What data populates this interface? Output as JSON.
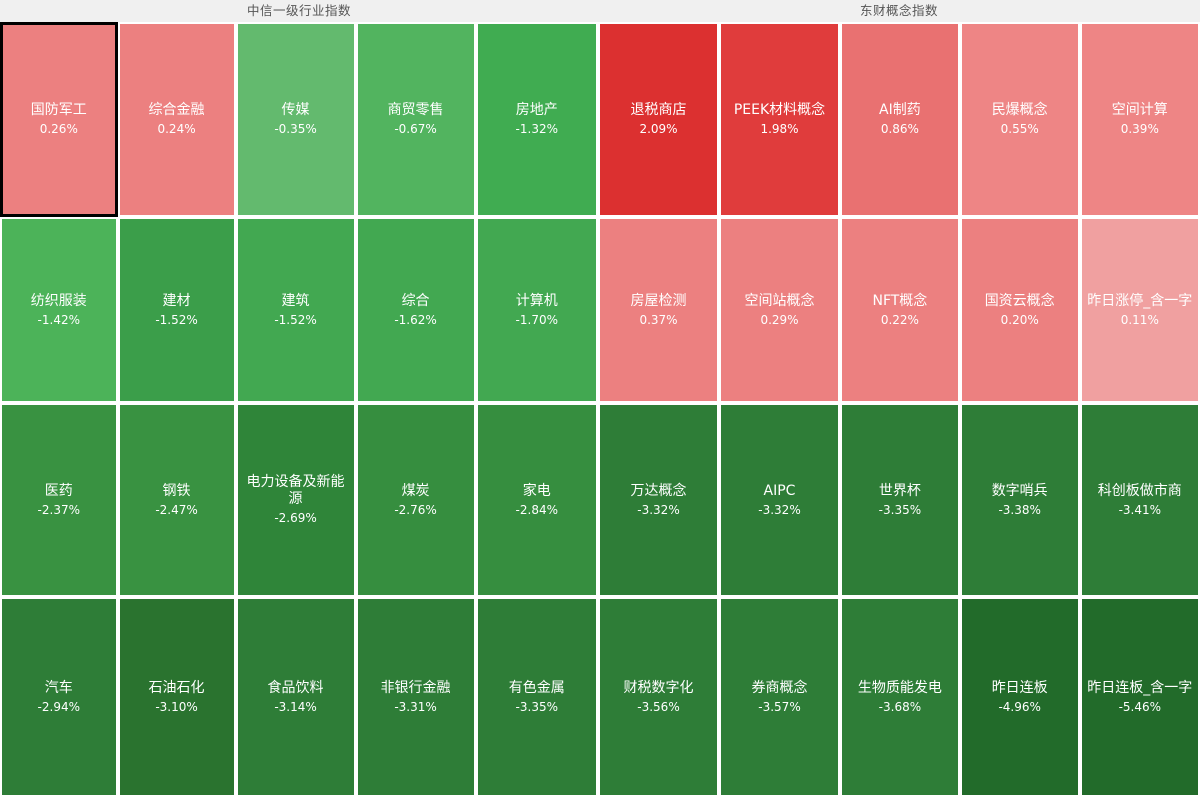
{
  "panels": [
    {
      "title": "中信一级行业指数",
      "rows": [
        {
          "height_pct": 25.2,
          "cells": [
            {
              "label": "国防军工",
              "value": "0.26%",
              "change": 0.26,
              "color": "#ec8080",
              "selected": true,
              "width_pct": 19.66
            },
            {
              "label": "综合金融",
              "value": "0.24%",
              "change": 0.24,
              "color": "#ec8080",
              "selected": false,
              "width_pct": 19.73
            },
            {
              "label": "传媒",
              "value": "-0.35%",
              "change": -0.35,
              "color": "#63ba6e",
              "selected": false,
              "width_pct": 20.07
            },
            {
              "label": "商贸零售",
              "value": "-0.67%",
              "change": -0.67,
              "color": "#52b45f",
              "selected": false,
              "width_pct": 20.07
            },
            {
              "label": "房地产",
              "value": "-1.32%",
              "change": -1.32,
              "color": "#40ac51",
              "selected": false,
              "width_pct": 20.47
            }
          ]
        },
        {
          "height_pct": 24.0,
          "cells": [
            {
              "label": "纺织服装",
              "value": "-1.42%",
              "change": -1.42,
              "color": "#4cb359",
              "selected": false,
              "width_pct": 19.66
            },
            {
              "label": "建材",
              "value": "-1.52%",
              "change": -1.52,
              "color": "#3b9e4a",
              "selected": false,
              "width_pct": 19.73
            },
            {
              "label": "建筑",
              "value": "-1.52%",
              "change": -1.52,
              "color": "#42a851",
              "selected": false,
              "width_pct": 20.07
            },
            {
              "label": "综合",
              "value": "-1.62%",
              "change": -1.62,
              "color": "#42a851",
              "selected": false,
              "width_pct": 20.07
            },
            {
              "label": "计算机",
              "value": "-1.70%",
              "change": -1.7,
              "color": "#42a851",
              "selected": false,
              "width_pct": 20.47
            }
          ]
        },
        {
          "height_pct": 25.0,
          "cells": [
            {
              "label": "医药",
              "value": "-2.37%",
              "change": -2.37,
              "color": "#399241",
              "selected": false,
              "width_pct": 19.66
            },
            {
              "label": "钢铁",
              "value": "-2.47%",
              "change": -2.47,
              "color": "#399241",
              "selected": false,
              "width_pct": 19.73
            },
            {
              "label": "电力设备及新能源",
              "value": "-2.69%",
              "change": -2.69,
              "color": "#2f8539",
              "selected": false,
              "width_pct": 20.07
            },
            {
              "label": "煤炭",
              "value": "-2.76%",
              "change": -2.76,
              "color": "#368e3f",
              "selected": false,
              "width_pct": 20.07
            },
            {
              "label": "家电",
              "value": "-2.84%",
              "change": -2.84,
              "color": "#368e3f",
              "selected": false,
              "width_pct": 20.47
            }
          ]
        },
        {
          "height_pct": 25.8,
          "cells": [
            {
              "label": "汽车",
              "value": "-2.94%",
              "change": -2.94,
              "color": "#2e7d37",
              "selected": false,
              "width_pct": 19.66
            },
            {
              "label": "石油石化",
              "value": "-3.10%",
              "change": -3.1,
              "color": "#2a732f",
              "selected": false,
              "width_pct": 19.73
            },
            {
              "label": "食品饮料",
              "value": "-3.14%",
              "change": -3.14,
              "color": "#2e7d37",
              "selected": false,
              "width_pct": 20.07
            },
            {
              "label": "非银行金融",
              "value": "-3.31%",
              "change": -3.31,
              "color": "#2e7d37",
              "selected": false,
              "width_pct": 20.07
            },
            {
              "label": "有色金属",
              "value": "-3.35%",
              "change": -3.35,
              "color": "#2e7d37",
              "selected": false,
              "width_pct": 20.47
            }
          ]
        }
      ]
    },
    {
      "title": "东财概念指数",
      "rows": [
        {
          "height_pct": 25.2,
          "cells": [
            {
              "label": "退税商店",
              "value": "2.09%",
              "change": 2.09,
              "color": "#dc3030",
              "selected": false,
              "width_pct": 20.1
            },
            {
              "label": "PEEK材料概念",
              "value": "1.98%",
              "change": 1.98,
              "color": "#e03c3c",
              "selected": false,
              "width_pct": 20.1
            },
            {
              "label": "AI制药",
              "value": "0.86%",
              "change": 0.86,
              "color": "#e97171",
              "selected": false,
              "width_pct": 19.9
            },
            {
              "label": "民爆概念",
              "value": "0.55%",
              "change": 0.55,
              "color": "#ee8585",
              "selected": false,
              "width_pct": 19.9
            },
            {
              "label": "空间计算",
              "value": "0.39%",
              "change": 0.39,
              "color": "#ee8585",
              "selected": false,
              "width_pct": 20.0
            }
          ]
        },
        {
          "height_pct": 24.0,
          "cells": [
            {
              "label": "房屋检测",
              "value": "0.37%",
              "change": 0.37,
              "color": "#ec8080",
              "selected": false,
              "width_pct": 20.1
            },
            {
              "label": "空间站概念",
              "value": "0.29%",
              "change": 0.29,
              "color": "#ec8080",
              "selected": false,
              "width_pct": 20.1
            },
            {
              "label": "NFT概念",
              "value": "0.22%",
              "change": 0.22,
              "color": "#ec8080",
              "selected": false,
              "width_pct": 19.9
            },
            {
              "label": "国资云概念",
              "value": "0.20%",
              "change": 0.2,
              "color": "#ec8080",
              "selected": false,
              "width_pct": 19.9
            },
            {
              "label": "昨日涨停_含一字",
              "value": "0.11%",
              "change": 0.11,
              "color": "#f0a0a0",
              "selected": false,
              "width_pct": 20.0
            }
          ]
        },
        {
          "height_pct": 25.0,
          "cells": [
            {
              "label": "万达概念",
              "value": "-3.32%",
              "change": -3.32,
              "color": "#2e7d37",
              "selected": false,
              "width_pct": 20.1
            },
            {
              "label": "AIPC",
              "value": "-3.32%",
              "change": -3.32,
              "color": "#2e7d37",
              "selected": false,
              "width_pct": 20.1
            },
            {
              "label": "世界杯",
              "value": "-3.35%",
              "change": -3.35,
              "color": "#2e7d37",
              "selected": false,
              "width_pct": 19.9
            },
            {
              "label": "数字哨兵",
              "value": "-3.38%",
              "change": -3.38,
              "color": "#2e7d37",
              "selected": false,
              "width_pct": 19.9
            },
            {
              "label": "科创板做市商",
              "value": "-3.41%",
              "change": -3.41,
              "color": "#2e7d37",
              "selected": false,
              "width_pct": 20.0
            }
          ]
        },
        {
          "height_pct": 25.8,
          "cells": [
            {
              "label": "财税数字化",
              "value": "-3.56%",
              "change": -3.56,
              "color": "#2e7d37",
              "selected": false,
              "width_pct": 20.1
            },
            {
              "label": "券商概念",
              "value": "-3.57%",
              "change": -3.57,
              "color": "#2e7d37",
              "selected": false,
              "width_pct": 20.1
            },
            {
              "label": "生物质能发电",
              "value": "-3.68%",
              "change": -3.68,
              "color": "#2e7d37",
              "selected": false,
              "width_pct": 19.9
            },
            {
              "label": "昨日连板",
              "value": "-4.96%",
              "change": -4.96,
              "color": "#226b2a",
              "selected": false,
              "width_pct": 19.9
            },
            {
              "label": "昨日连板_含一字",
              "value": "-5.46%",
              "change": -5.46,
              "color": "#226b2a",
              "selected": false,
              "width_pct": 20.0
            }
          ]
        }
      ]
    }
  ],
  "theme": {
    "background": "#f0f0f0",
    "gap_color": "#ffffff",
    "title_color": "#555555",
    "text_color": "#ffffff",
    "selected_border_color": "#000000",
    "up_color": "#dc3030",
    "down_color": "#2e7d37"
  },
  "chart_data": {
    "type": "heatmap",
    "title": "",
    "subtitle": "",
    "xlabel": "",
    "ylabel": "",
    "legend_position": "none",
    "grid": false,
    "groups": [
      {
        "name": "中信一级行业指数",
        "items": [
          {
            "label": "国防军工",
            "value": 0.26
          },
          {
            "label": "综合金融",
            "value": 0.24
          },
          {
            "label": "传媒",
            "value": -0.35
          },
          {
            "label": "商贸零售",
            "value": -0.67
          },
          {
            "label": "房地产",
            "value": -1.32
          },
          {
            "label": "纺织服装",
            "value": -1.42
          },
          {
            "label": "建材",
            "value": -1.52
          },
          {
            "label": "建筑",
            "value": -1.52
          },
          {
            "label": "综合",
            "value": -1.62
          },
          {
            "label": "计算机",
            "value": -1.7
          },
          {
            "label": "医药",
            "value": -2.37
          },
          {
            "label": "钢铁",
            "value": -2.47
          },
          {
            "label": "电力设备及新能源",
            "value": -2.69
          },
          {
            "label": "煤炭",
            "value": -2.76
          },
          {
            "label": "家电",
            "value": -2.84
          },
          {
            "label": "汽车",
            "value": -2.94
          },
          {
            "label": "石油石化",
            "value": -3.1
          },
          {
            "label": "食品饮料",
            "value": -3.14
          },
          {
            "label": "非银行金融",
            "value": -3.31
          },
          {
            "label": "有色金属",
            "value": -3.35
          }
        ]
      },
      {
        "name": "东财概念指数",
        "items": [
          {
            "label": "退税商店",
            "value": 2.09
          },
          {
            "label": "PEEK材料概念",
            "value": 1.98
          },
          {
            "label": "AI制药",
            "value": 0.86
          },
          {
            "label": "民爆概念",
            "value": 0.55
          },
          {
            "label": "空间计算",
            "value": 0.39
          },
          {
            "label": "房屋检测",
            "value": 0.37
          },
          {
            "label": "空间站概念",
            "value": 0.29
          },
          {
            "label": "NFT概念",
            "value": 0.22
          },
          {
            "label": "国资云概念",
            "value": 0.2
          },
          {
            "label": "昨日涨停_含一字",
            "value": 0.11
          },
          {
            "label": "万达概念",
            "value": -3.32
          },
          {
            "label": "AIPC",
            "value": -3.32
          },
          {
            "label": "世界杯",
            "value": -3.35
          },
          {
            "label": "数字哨兵",
            "value": -3.38
          },
          {
            "label": "科创板做市商",
            "value": -3.41
          },
          {
            "label": "财税数字化",
            "value": -3.56
          },
          {
            "label": "券商概念",
            "value": -3.57
          },
          {
            "label": "生物质能发电",
            "value": -3.68
          },
          {
            "label": "昨日连板",
            "value": -4.96
          },
          {
            "label": "昨日连板_含一字",
            "value": -5.46
          }
        ]
      }
    ]
  }
}
